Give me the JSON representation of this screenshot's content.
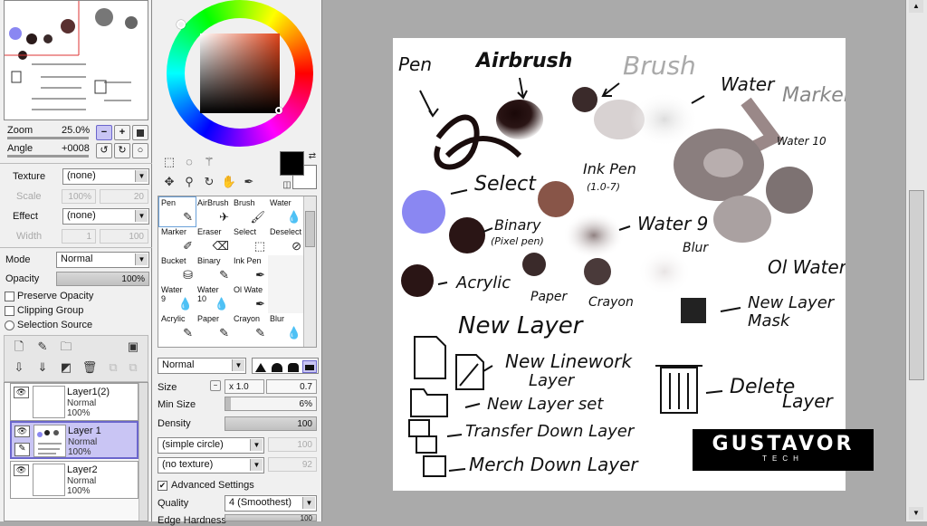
{
  "navigator": {
    "zoom_label": "Zoom",
    "zoom_value": "25.0%",
    "angle_label": "Angle",
    "angle_value": "+0008"
  },
  "brush": {
    "texture_label": "Texture",
    "texture_value": "(none)",
    "scale_label": "Scale",
    "scale_value": "100%",
    "scale_num": "20",
    "effect_label": "Effect",
    "effect_value": "(none)",
    "width_label": "Width",
    "width_value": "1",
    "width_num": "100"
  },
  "layer_props": {
    "mode_label": "Mode",
    "mode_value": "Normal",
    "opacity_label": "Opacity",
    "opacity_value": "100%",
    "preserve_opacity": "Preserve Opacity",
    "clipping_group": "Clipping Group",
    "selection_source": "Selection Source"
  },
  "layers": [
    {
      "name": "Layer1(2)",
      "mode": "Normal",
      "opacity": "100%"
    },
    {
      "name": "Layer 1",
      "mode": "Normal",
      "opacity": "100%"
    },
    {
      "name": "Layer2",
      "mode": "Normal",
      "opacity": "100%"
    }
  ],
  "tools": [
    {
      "l1": "Pen",
      "icon": "pen-icon"
    },
    {
      "l1": "AirBrush",
      "icon": "airbrush-icon"
    },
    {
      "l1": "Brush",
      "icon": "brush-icon"
    },
    {
      "l1": "Water",
      "icon": "water-icon"
    },
    {
      "l1": "Marker",
      "icon": "marker-icon"
    },
    {
      "l1": "Eraser",
      "icon": "eraser-icon"
    },
    {
      "l1": "Select",
      "icon": "select-icon"
    },
    {
      "l1": "Deselect",
      "icon": "deselect-icon"
    },
    {
      "l1": "Bucket",
      "icon": "bucket-icon"
    },
    {
      "l1": "Binary",
      "icon": "binary-icon"
    },
    {
      "l1": "Ink Pen",
      "icon": "ink-pen-icon"
    },
    {
      "l1": "",
      "icon": ""
    },
    {
      "l1": "Water",
      "l2": "9",
      "icon": "water-icon"
    },
    {
      "l1": "Water",
      "l2": "10",
      "icon": "water-icon"
    },
    {
      "l1": "Ol Wate",
      "icon": "oil-water-icon"
    },
    {
      "l1": "",
      "icon": ""
    },
    {
      "l1": "Acrylic",
      "icon": "acrylic-icon"
    },
    {
      "l1": "Paper",
      "icon": "paper-icon"
    },
    {
      "l1": "Crayon",
      "icon": "crayon-icon"
    },
    {
      "l1": "Blur",
      "icon": "blur-icon"
    }
  ],
  "tool_settings": {
    "mode_value": "Normal",
    "size_label": "Size",
    "size_mult": "x 1.0",
    "size_value": "0.7",
    "min_size_label": "Min Size",
    "min_size_value": "6%",
    "density_label": "Density",
    "density_value": "100",
    "shape_value": "(simple circle)",
    "shape_num": "100",
    "texture_value": "(no texture)",
    "texture_num": "92",
    "advanced_label": "Advanced Settings",
    "quality_label": "Quality",
    "quality_value": "4 (Smoothest)",
    "edge_label": "Edge Hardness",
    "edge_value": "100"
  },
  "colors": {
    "accent": "#6b66cc",
    "swatch_blue": "#8a87f2",
    "fg_color": "#000000",
    "bg_color": "#ffffff"
  },
  "canvas_text": {
    "pen": "Pen",
    "airbrush": "Airbrush",
    "brush": "Brush",
    "water": "Water",
    "marker": "Marker",
    "water10": "Water 10",
    "select": "Select",
    "ink_pen": "Ink Pen",
    "ink_pen_sub": "(1.0-7)",
    "binary": "Binary",
    "binary_sub": "(Pixel pen)",
    "water9": "Water 9",
    "blur": "Blur",
    "oil_water": "Ol Water",
    "acrylic": "Acrylic",
    "paper": "Paper",
    "crayon": "Crayon",
    "new_layer_mask_1": "New Layer",
    "new_layer_mask_2": "Mask",
    "new_layer": "New Layer",
    "new_linework_1": "New Linework",
    "new_linework_2": "Layer",
    "new_layer_set": "New Layer set",
    "delete_1": "Delete",
    "delete_2": "Layer",
    "transfer_down": "Transfer Down Layer",
    "merge_down": "Merch Down Layer"
  },
  "watermark": {
    "line1": "GUSTAVOR",
    "line2": "TECH"
  }
}
